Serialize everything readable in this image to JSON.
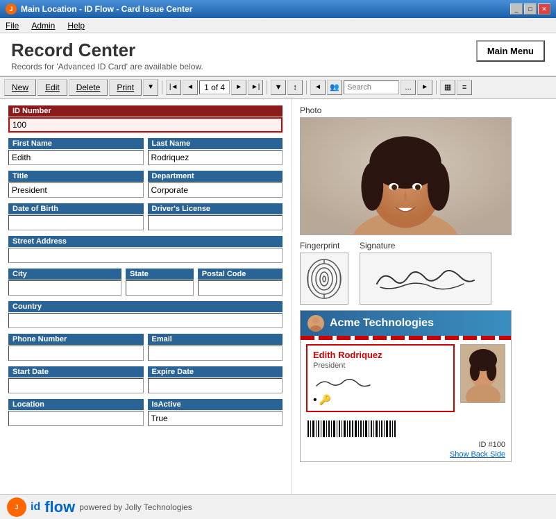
{
  "window": {
    "title": "Main Location - ID Flow - Card Issue Center",
    "icon": "app-icon"
  },
  "menu": {
    "items": [
      "File",
      "Admin",
      "Help"
    ]
  },
  "header": {
    "title": "Record Center",
    "subtitle": "Records for 'Advanced ID Card' are available below.",
    "main_menu_label": "Main Menu"
  },
  "toolbar": {
    "new_label": "New",
    "edit_label": "Edit",
    "delete_label": "Delete",
    "print_label": "Print",
    "record_count": "1 of 4",
    "search_placeholder": "Search"
  },
  "form": {
    "id_number_label": "ID Number",
    "id_number_value": "100",
    "first_name_label": "First Name",
    "first_name_value": "Edith",
    "last_name_label": "Last Name",
    "last_name_value": "Rodriquez",
    "title_label": "Title",
    "title_value": "President",
    "department_label": "Department",
    "department_value": "Corporate",
    "dob_label": "Date of Birth",
    "dob_value": "",
    "drivers_license_label": "Driver's License",
    "drivers_license_value": "",
    "street_address_label": "Street Address",
    "street_address_value": "",
    "city_label": "City",
    "city_value": "",
    "state_label": "State",
    "state_value": "",
    "postal_code_label": "Postal Code",
    "postal_code_value": "",
    "country_label": "Country",
    "country_value": "",
    "phone_label": "Phone Number",
    "phone_value": "",
    "email_label": "Email",
    "email_value": "",
    "start_date_label": "Start Date",
    "start_date_value": "",
    "expire_date_label": "Expire Date",
    "expire_date_value": "",
    "location_label": "Location",
    "location_value": "",
    "is_active_label": "IsActive",
    "is_active_value": "True"
  },
  "photo_section": {
    "label": "Photo",
    "fingerprint_label": "Fingerprint",
    "signature_label": "Signature"
  },
  "card_preview": {
    "company_name": "Acme Technologies",
    "person_name": "Edith Rodriquez",
    "person_title": "President",
    "id_number": "ID #100",
    "show_back_label": "Show Back Side"
  },
  "bottom_bar": {
    "powered_by": "powered by Jolly Technologies",
    "id_text": "id",
    "flow_text": "flow"
  }
}
